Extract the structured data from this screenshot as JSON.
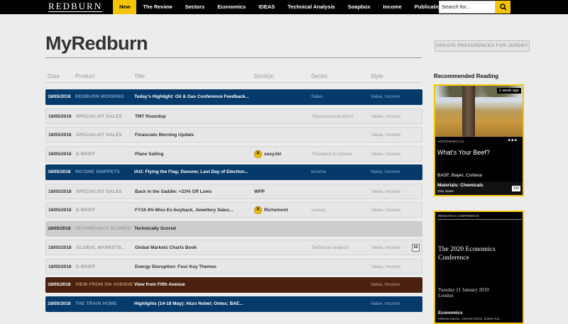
{
  "header": {
    "logo": "REDBURN",
    "nav": [
      "New",
      "The Review",
      "Sectors",
      "Economics",
      "IDEAS",
      "Technical Analysis",
      "Soapbox",
      "Income",
      "Publications"
    ],
    "search_placeholder": "Search for...",
    "accent": "#f5c400"
  },
  "page": {
    "title": "MyRedburn",
    "preferences_button": "UPDATE PREFERENCES FOR JEREMY"
  },
  "table": {
    "headers": [
      "Date",
      "Product",
      "Title",
      "Stock(s)",
      "Sector",
      "Style"
    ],
    "rows": [
      {
        "date": "18/05/2018",
        "product": "REDBURN MORNING",
        "title": "Today's Highlight: Oil & Gas Conference Feedback...",
        "stock": "",
        "sector": "Sales",
        "style": "Value, Income",
        "variant": "blue"
      },
      {
        "date": "18/05/2018",
        "product": "SPECIALIST SALES",
        "title": "TMT Roundup",
        "stock": "",
        "sector": "Telecommunications",
        "style": "Value, Income",
        "variant": "light"
      },
      {
        "date": "18/05/2018",
        "product": "SPECIALIST SALES",
        "title": "Financials Morning Update",
        "stock": "",
        "sector": "",
        "style": "Value, Income",
        "variant": "light"
      },
      {
        "date": "18/05/2018",
        "product": "E-BRIEF",
        "title": "Plane Sailing",
        "stock": "easyJet",
        "sector": "Transport & Leisure",
        "style": "Value, Income",
        "variant": "light"
      },
      {
        "date": "18/05/2018",
        "product": "INCOME SNIPPETS",
        "title": "IAG: Flying the Flag; Danone; Last Day of Election...",
        "stock": "",
        "sector": "Income",
        "style": "Value, Income",
        "variant": "blue"
      },
      {
        "date": "18/05/2018",
        "product": "SPECIALIST SALES",
        "title": "Back in the Saddle: +23% Off Lows",
        "stock": "WPP",
        "sector": "",
        "style": "Value, Income",
        "variant": "light"
      },
      {
        "date": "18/05/2018",
        "product": "E-BRIEF",
        "title": "FY18 4% Miss Ex-buyback, Jewellery Sales...",
        "stock": "Richemont",
        "sector": "Luxury",
        "style": "Value, Income",
        "variant": "light"
      },
      {
        "date": "18/05/2018",
        "product": "TECHNICALLY SCORED",
        "title": "Technically Scored",
        "stock": "",
        "sector": "",
        "style": "",
        "variant": "gray"
      },
      {
        "date": "18/05/2018",
        "product": "GLOBAL MARKETS...",
        "title": "Global Markets Charts Book",
        "stock": "",
        "sector": "Technical Analysis",
        "style": "Value, Income",
        "variant": "light",
        "badge": "55"
      },
      {
        "date": "18/05/2018",
        "product": "E-BRIEF",
        "title": "Energy Disruption: Four Key Themes",
        "stock": "",
        "sector": "",
        "style": "Value, Income",
        "variant": "light"
      },
      {
        "date": "18/05/2018",
        "product": "VIEW FROM 5th AVENUE",
        "title": "View from Fifth Avenue",
        "stock": "",
        "sector": "",
        "style": "Value, Income",
        "variant": "brown"
      },
      {
        "date": "18/05/2018",
        "product": "THE TRAIN HOME",
        "title": "Highlights (14-18 May): Akzo Nobel; Ontex; BAE...",
        "stock": "",
        "sector": "",
        "style": "Value, Income",
        "variant": "blue"
      }
    ]
  },
  "recommended": {
    "title": "Recommended Reading",
    "card1": {
      "tag": "1 week ago",
      "category": "AGRICHEMICALS",
      "headline": "What's Your Beef?",
      "companies": "BASF, Bayer, Corteva",
      "sector": "Materials: Chemicals",
      "author": "Tony Jones",
      "pages": "109"
    },
    "card2": {
      "category": "RESEARCH CONFERENCE",
      "headline": "The 2020 Economics Conference",
      "date": "Tuesday 21 January 2019",
      "location": "London",
      "sector": "Economics",
      "authors": "Melissa Davies, Carmelo Efess, Robert Kar..."
    }
  }
}
